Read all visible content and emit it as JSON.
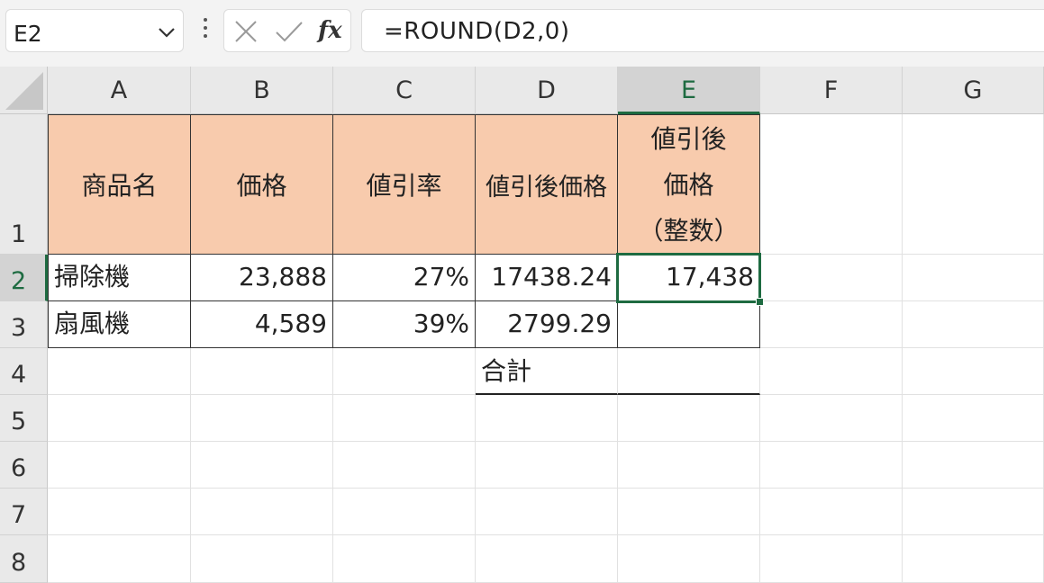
{
  "formula_bar": {
    "name_box": "E2",
    "formula": "=ROUND(D2,0)",
    "fx_label": "fx"
  },
  "columns": [
    "A",
    "B",
    "C",
    "D",
    "E",
    "F",
    "G"
  ],
  "rows": [
    "1",
    "2",
    "3",
    "4",
    "5",
    "6",
    "7",
    "8"
  ],
  "table": {
    "header": {
      "A": "商品名",
      "B": "価格",
      "C": "値引率",
      "D": "値引後価格",
      "E_line1": "値引後",
      "E_line2": "価格",
      "E_line3": "（整数）"
    },
    "rows": [
      {
        "A": "掃除機",
        "B": "23,888",
        "C": "27%",
        "D": "17438.24",
        "E": "17,438"
      },
      {
        "A": "扇風機",
        "B": "4,589",
        "C": "39%",
        "D": "2799.29",
        "E": ""
      }
    ],
    "total_label": "合計"
  },
  "colors": {
    "header_fill": "#f8cbad",
    "selection": "#1e6b41"
  },
  "selected_cell": "E2"
}
